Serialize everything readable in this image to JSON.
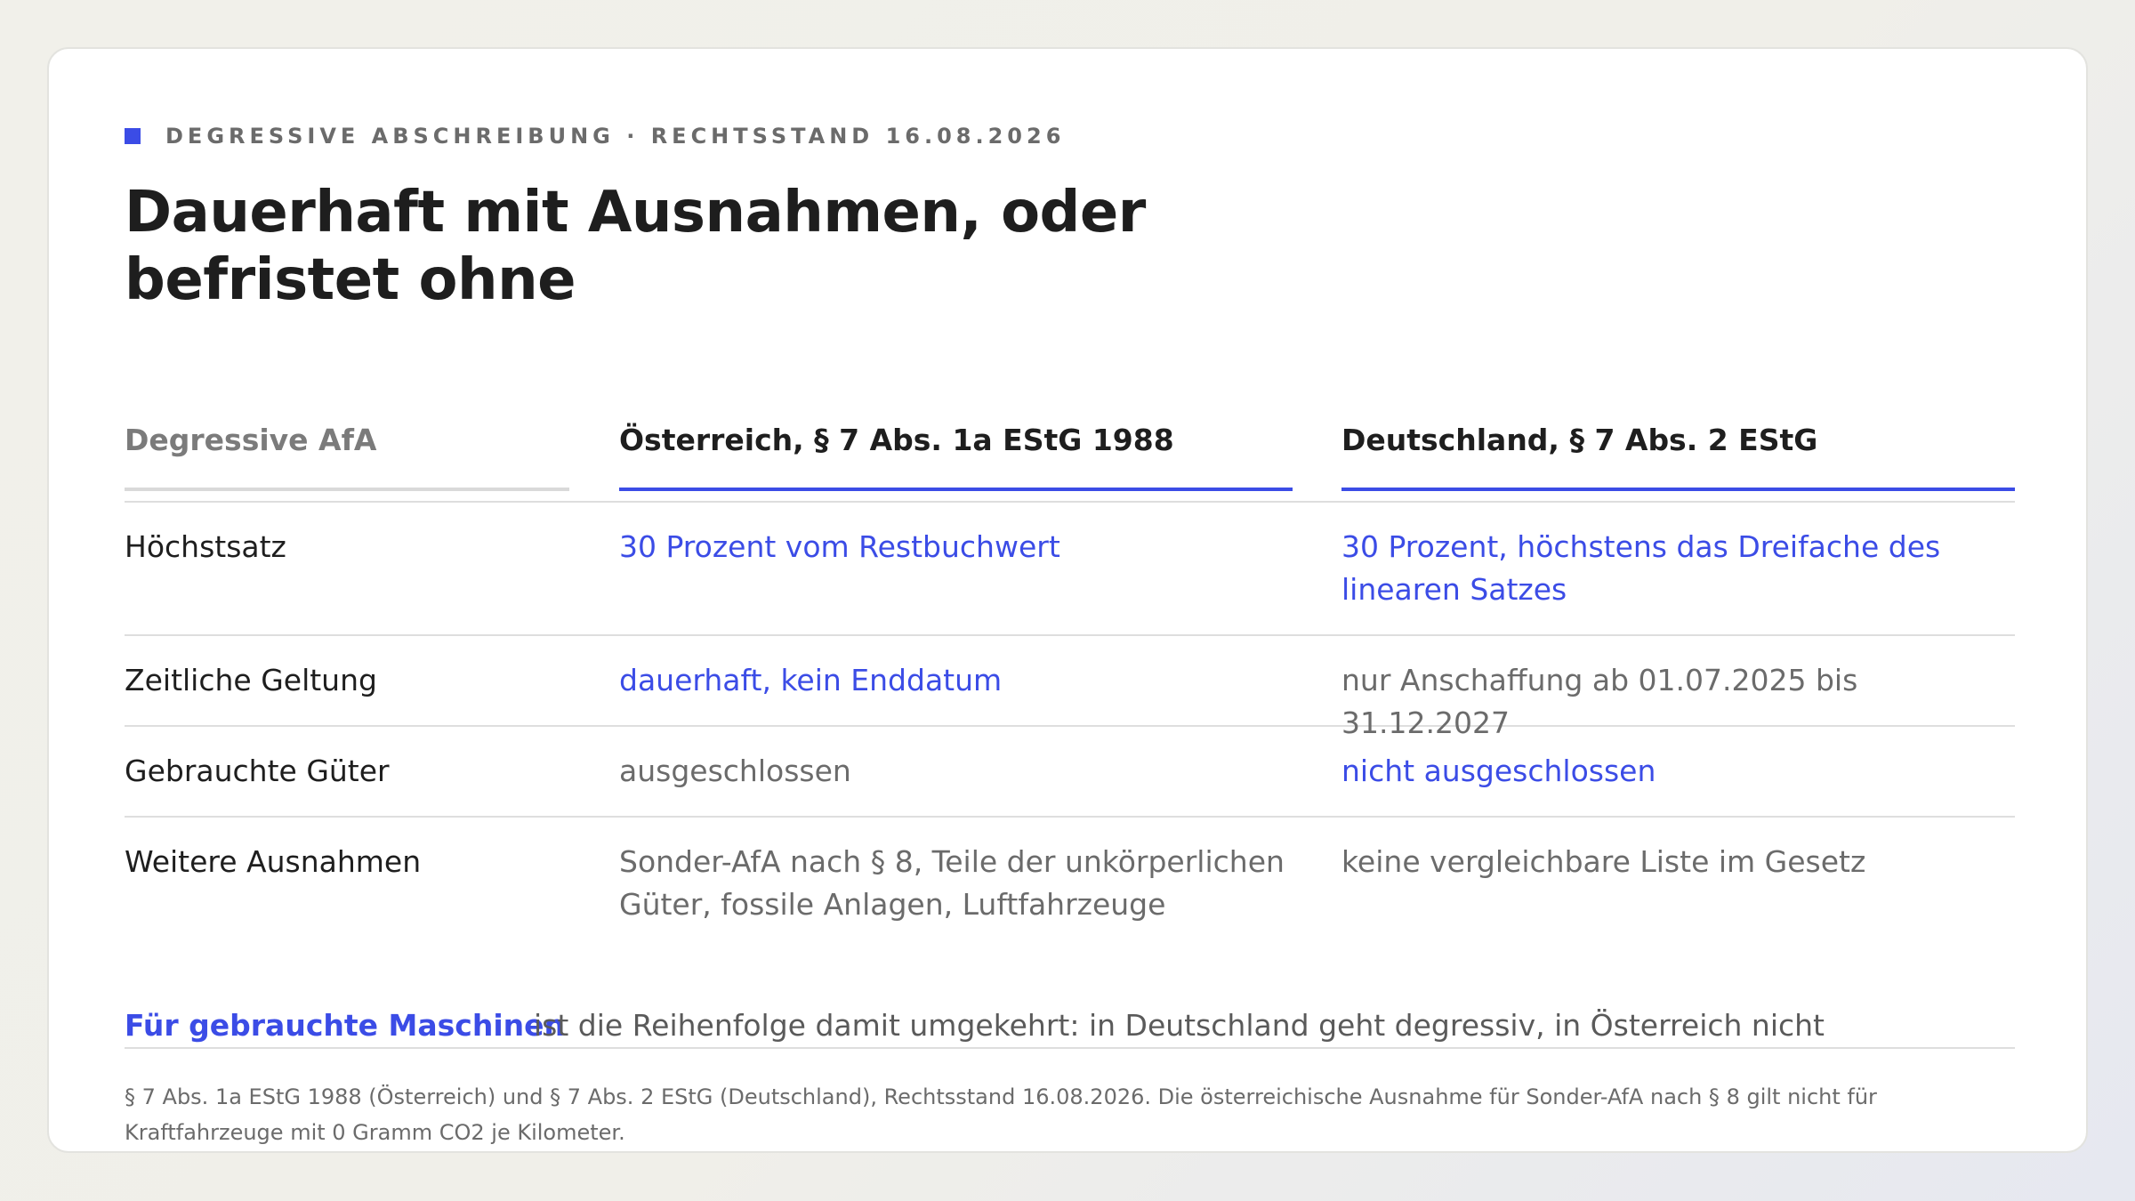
{
  "header": {
    "kicker": "DEGRESSIVE ABSCHREIBUNG · RECHTSSTAND 16.08.2026",
    "title_line1": "Dauerhaft mit Ausnahmen, oder",
    "title_line2": "befristet ohne"
  },
  "table": {
    "columns": [
      "Degressive AfA",
      "Österreich, § 7 Abs. 1a EStG 1988",
      "Deutschland, § 7 Abs. 2 EStG"
    ],
    "rows": [
      {
        "label": "Höchstsatz",
        "at": "30 Prozent vom Restbuchwert",
        "de_line1": "30 Prozent, höchstens das Dreifache des",
        "de_line2": "linearen Satzes"
      },
      {
        "label": "Zeitliche Geltung",
        "at": "dauerhaft, kein Enddatum",
        "de": "nur Anschaffung ab 01.07.2025 bis 31.12.2027"
      },
      {
        "label": "Gebrauchte Güter",
        "at": "ausgeschlossen",
        "de": "nicht ausgeschlossen"
      },
      {
        "label": "Weitere Ausnahmen",
        "at_line1": "Sonder-AfA nach § 8, Teile der unkörperlichen",
        "at_line2": "Güter, fossile Anlagen, Luftfahrzeuge",
        "de": "keine vergleichbare Liste im Gesetz"
      }
    ]
  },
  "summary": {
    "lead": "Für gebrauchte Maschinen",
    "text": "ist die Reihenfolge damit umgekehrt: in Deutschland geht degressiv, in Österreich nicht"
  },
  "footnote": {
    "line1": "§ 7 Abs. 1a EStG 1988 (Österreich) und § 7 Abs. 2 EStG (Deutschland), Rechtsstand 16.08.2026. Die österreichische Ausnahme für Sonder-AfA nach § 8 gilt nicht für",
    "line2": "Kraftfahrzeuge mit 0 Gramm CO2 je Kilometer."
  },
  "colors": {
    "accent": "#3b4ce6",
    "text": "#1e1e1e",
    "muted": "#6b6b6b",
    "rule": "#dedede"
  }
}
